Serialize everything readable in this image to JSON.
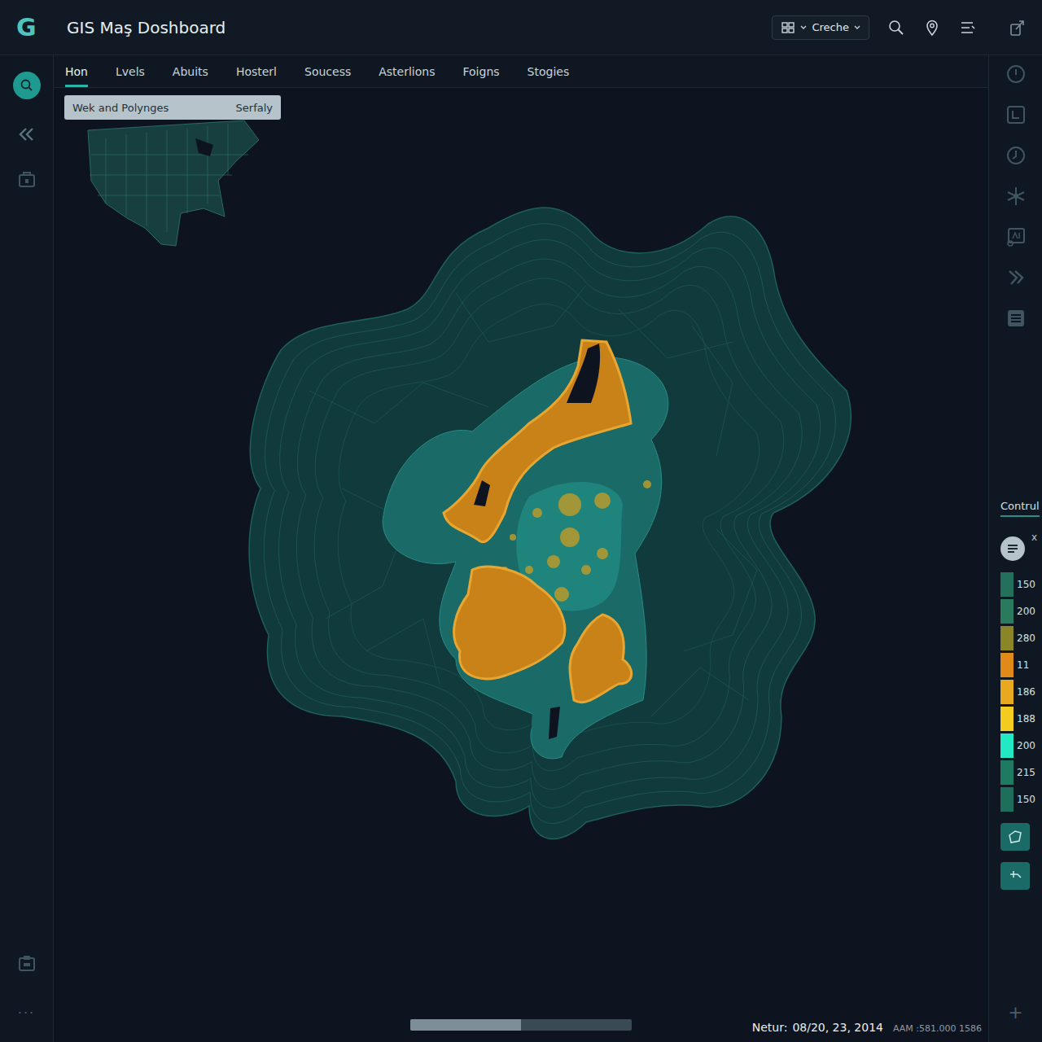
{
  "window": {
    "title": "GIS Maş Doshboard"
  },
  "logo": "G",
  "toolbar": {
    "dropdown": "Creche"
  },
  "tabs": [
    {
      "label": "Hon",
      "selected": true
    },
    {
      "label": "Lvels",
      "selected": false
    },
    {
      "label": "Abuits",
      "selected": false
    },
    {
      "label": "Hosterl",
      "selected": false
    },
    {
      "label": "Soucess",
      "selected": false
    },
    {
      "label": "Asterlions",
      "selected": false
    },
    {
      "label": "Foigns",
      "selected": false
    },
    {
      "label": "Stogies",
      "selected": false
    }
  ],
  "layer_panel": {
    "label": "Wek and Polynges",
    "value": "Serfaly"
  },
  "left_sidebar": {
    "more": "···"
  },
  "legend": {
    "title": "Contrul",
    "close": "x",
    "add": "+",
    "items": [
      {
        "value": "150",
        "color": "#23705c"
      },
      {
        "value": "200",
        "color": "#2a7a5e"
      },
      {
        "value": "280",
        "color": "#8a8628"
      },
      {
        "value": "11",
        "color": "#e08a1a"
      },
      {
        "value": "186",
        "color": "#e8a820"
      },
      {
        "value": "188",
        "color": "#f2cc1e"
      },
      {
        "value": "200",
        "color": "#22e8c4"
      },
      {
        "value": "215",
        "color": "#1f7a62"
      },
      {
        "value": "150",
        "color": "#1d6e5a"
      }
    ]
  },
  "scrollbar": {
    "level": 0.5
  },
  "status_bar": {
    "label": "Netur:",
    "date": "08/20, 23, 2014",
    "coords": "AAM :581.000 1586"
  }
}
